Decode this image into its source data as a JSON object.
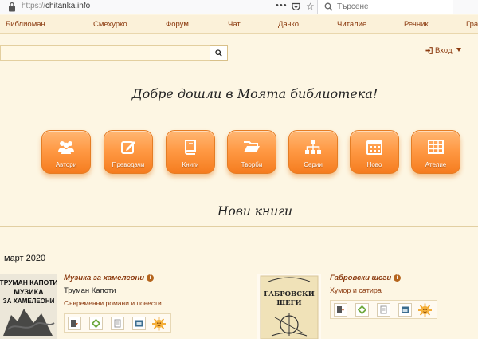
{
  "browser": {
    "url_scheme": "https://",
    "url_host": "chitanka.info",
    "menu_dots": "•••",
    "search_placeholder": "Търсене"
  },
  "nav": {
    "items": [
      "Библиоман",
      "Смехурко",
      "Форум",
      "Чат",
      "Дачко",
      "Читалие",
      "Речник",
      "Гра"
    ]
  },
  "login": {
    "label": "Вход"
  },
  "welcome": "Добре дошли в Моята библиотека!",
  "categories": [
    {
      "label": "Автори",
      "icon": "users-icon"
    },
    {
      "label": "Преводачи",
      "icon": "edit-icon"
    },
    {
      "label": "Книги",
      "icon": "book-icon"
    },
    {
      "label": "Творби",
      "icon": "folder-open-icon"
    },
    {
      "label": "Серии",
      "icon": "sitemap-icon"
    },
    {
      "label": "Ново",
      "icon": "calendar-icon"
    },
    {
      "label": "Ателие",
      "icon": "table-icon"
    }
  ],
  "new_books_heading": "Нови книги",
  "date": "март 2020",
  "books": [
    {
      "title": "Музика за хамелеони",
      "author": "Труман Капоти",
      "genre": "Съвременни романи и повести",
      "cover_lines": [
        "ТРУМАН КАПОТИ",
        "МУЗИКА",
        "ЗА ХАМЕЛЕОНИ"
      ]
    },
    {
      "title": "Габровски шеги",
      "author": "Хумор и сатира",
      "cover_lines": [
        "ГАБРОВСКИ",
        "ШЕГИ"
      ]
    }
  ],
  "colors": {
    "accent_link": "#8b3a0f",
    "button_orange": "#ff9a45",
    "page_bg": "#fdf6e3"
  }
}
